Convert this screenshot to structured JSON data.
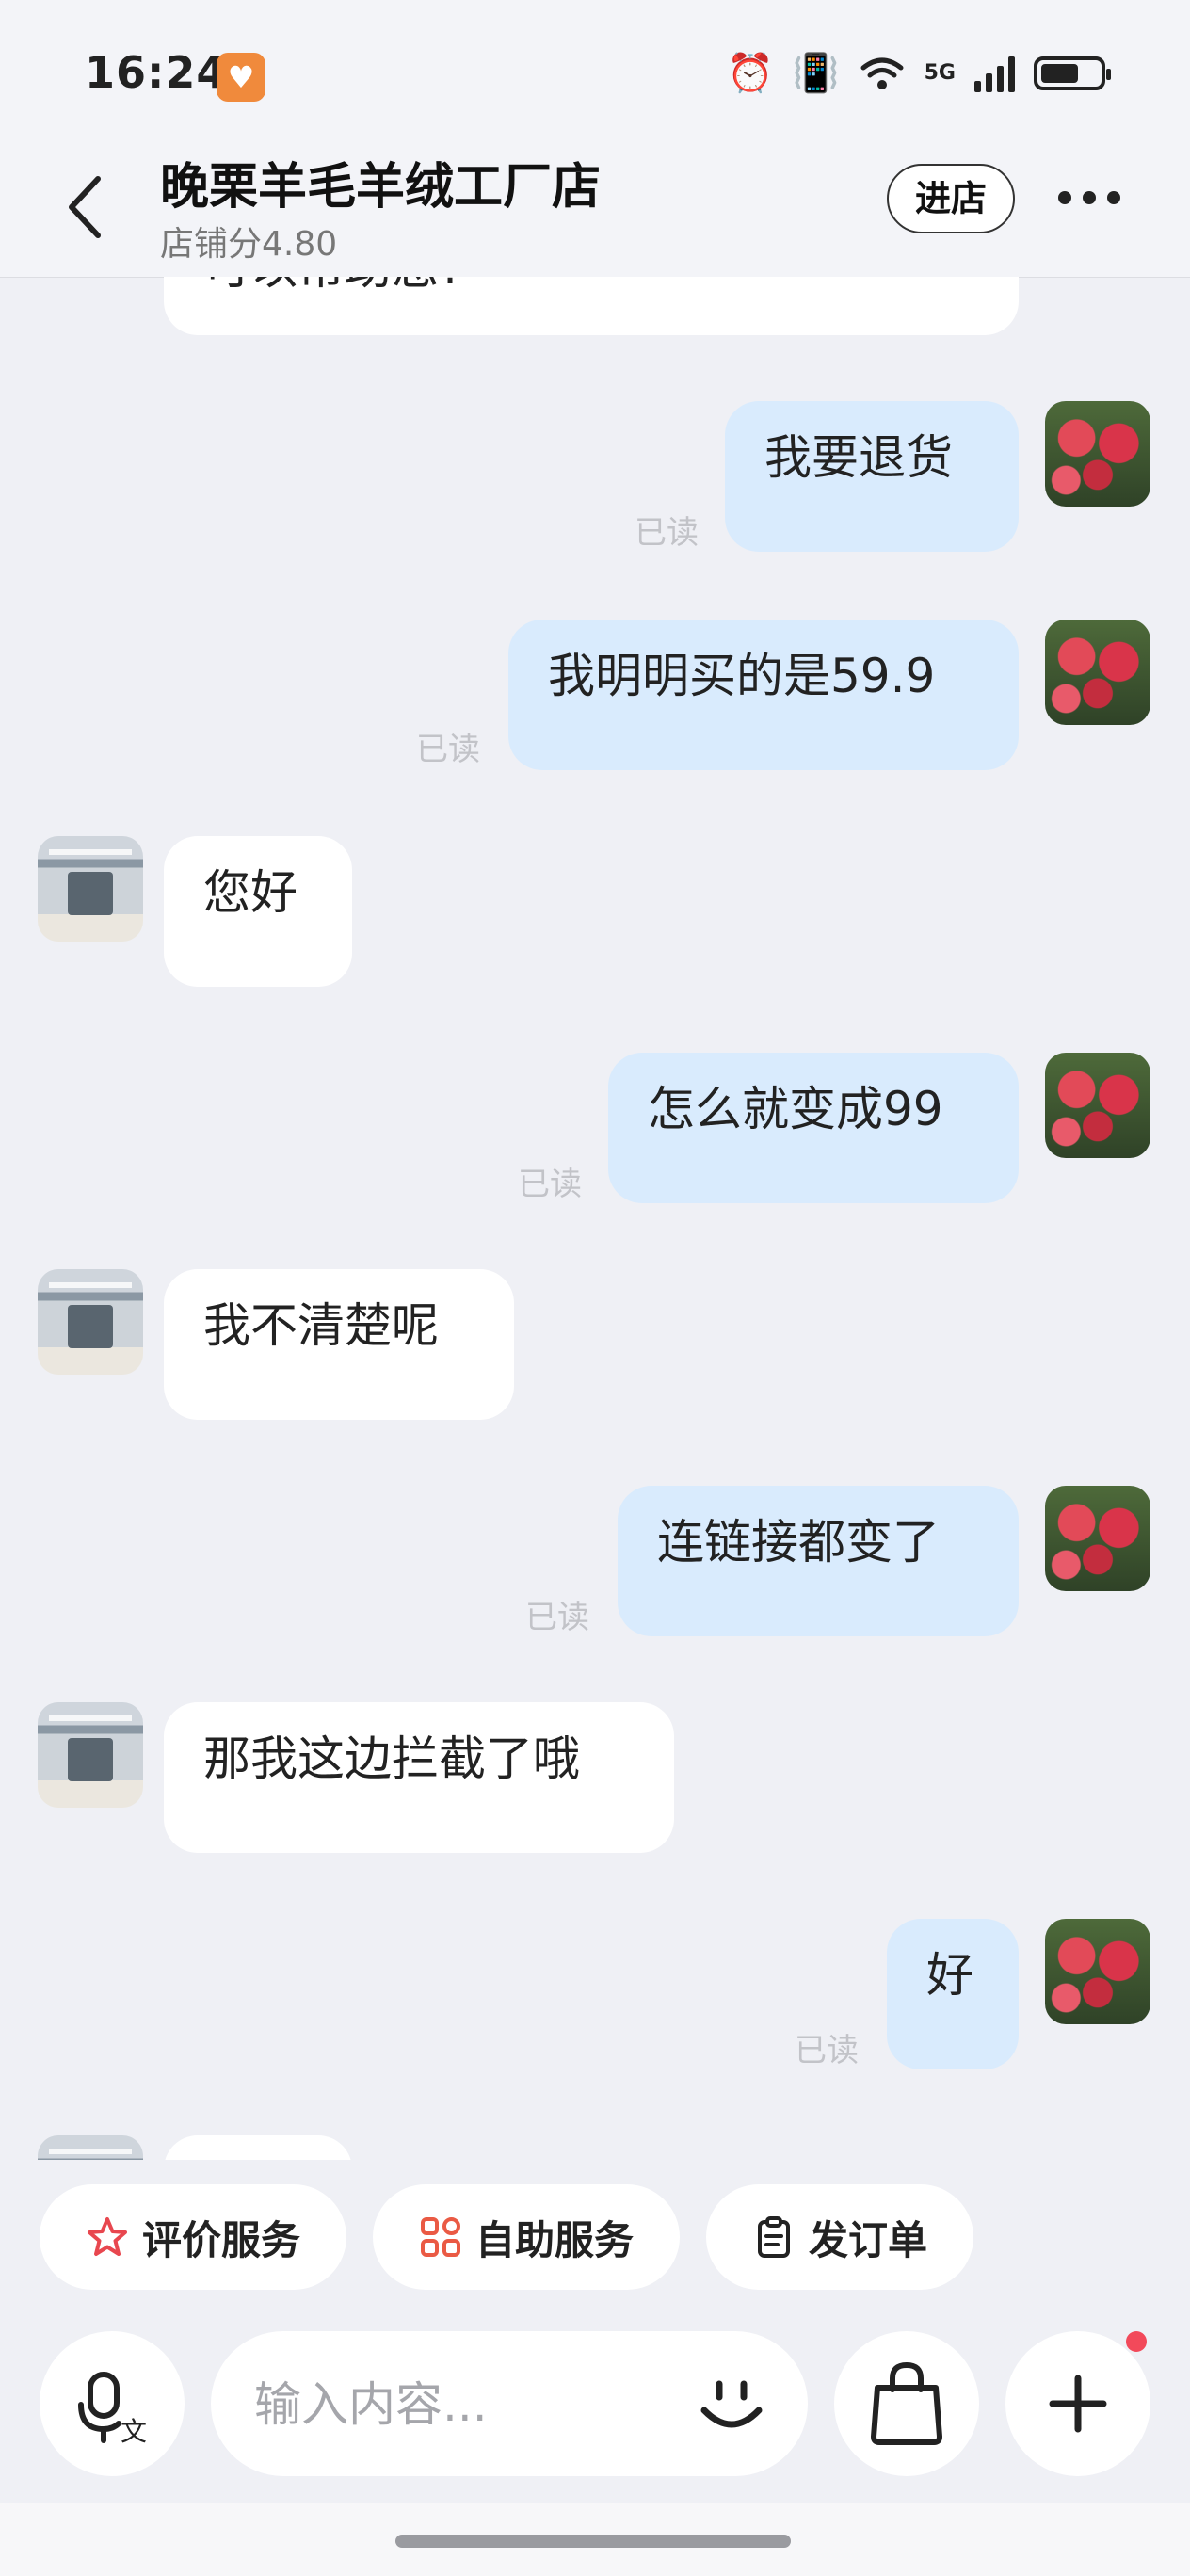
{
  "status_bar": {
    "time": "16:24",
    "network_label": "5G"
  },
  "header": {
    "shop_name": "晚栗羊毛羊绒工厂店",
    "shop_score": "店铺分4.80",
    "enter_button": "进店"
  },
  "messages": [
    {
      "from": "shop",
      "text": "可以帮助您?"
    },
    {
      "from": "user",
      "text": "我要退货",
      "status": "已读"
    },
    {
      "from": "user",
      "text": "我明明买的是59.9",
      "status": "已读"
    },
    {
      "from": "shop",
      "text": "您好"
    },
    {
      "from": "user",
      "text": "怎么就变成99",
      "status": "已读"
    },
    {
      "from": "shop",
      "text": "我不清楚呢"
    },
    {
      "from": "user",
      "text": "连链接都变了",
      "status": "已读"
    },
    {
      "from": "shop",
      "text": "那我这边拦截了哦"
    },
    {
      "from": "user",
      "text": "好",
      "status": "已读"
    }
  ],
  "quick_actions": [
    {
      "label": "评价服务",
      "icon": "star-icon"
    },
    {
      "label": "自助服务",
      "icon": "grid-icon"
    },
    {
      "label": "发订单",
      "icon": "clipboard-icon"
    }
  ],
  "input_bar": {
    "placeholder": "输入内容...",
    "voice_icon": "voice-translate-icon",
    "emoji_icon": "smiley-icon",
    "bag_icon": "shopping-bag-icon",
    "plus_icon": "plus-icon"
  },
  "colors": {
    "background": "#eff0f5",
    "outgoing_bubble": "#d9ebfd",
    "incoming_bubble": "#ffffff",
    "notification_dot": "#f2495a"
  }
}
